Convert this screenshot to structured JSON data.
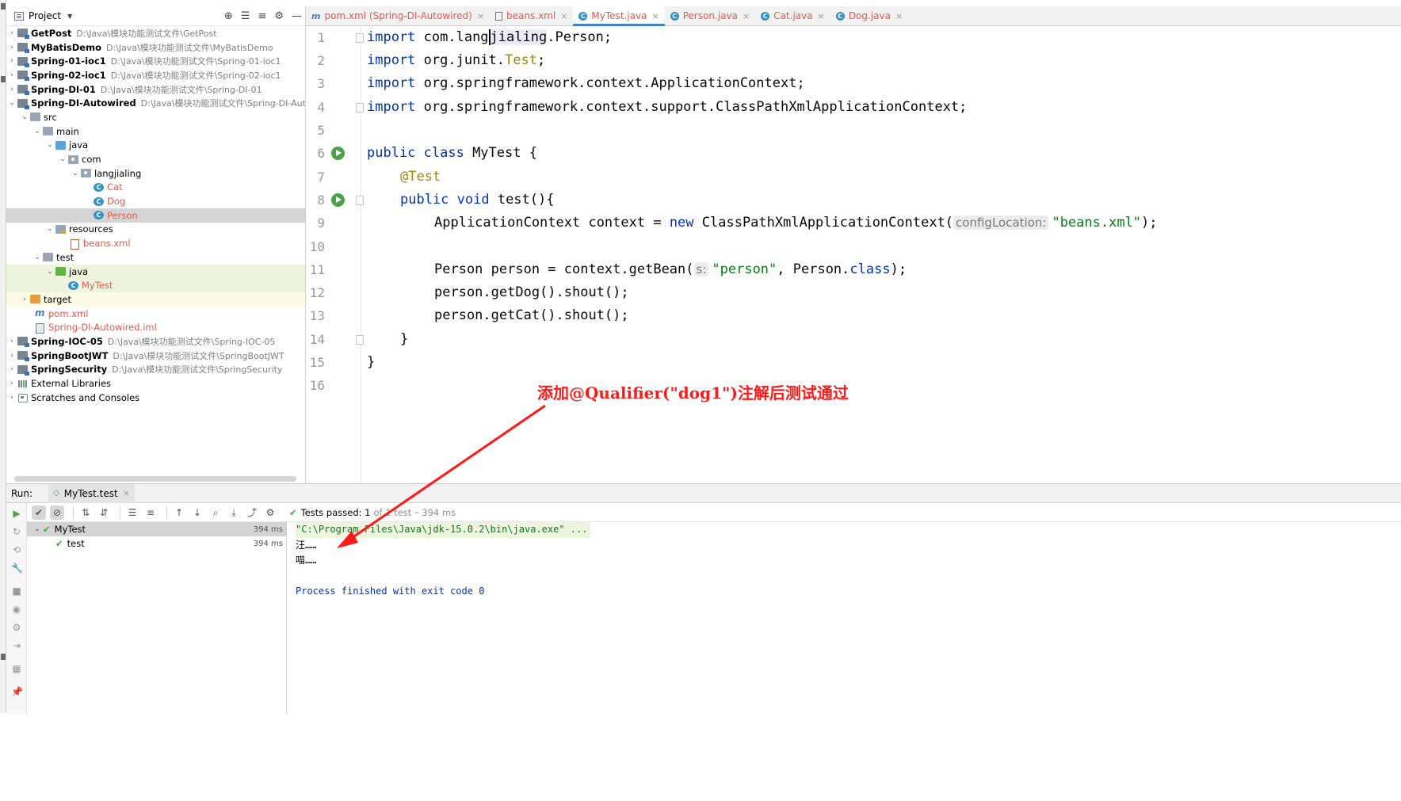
{
  "project": {
    "title": "Project",
    "tree": [
      {
        "name": "GetPost",
        "path": "D:\\Java\\模块功能测试文件\\GetPost"
      },
      {
        "name": "MyBatisDemo",
        "path": "D:\\Java\\模块功能测试文件\\MyBatisDemo"
      },
      {
        "name": "Spring-01-ioc1",
        "path": "D:\\Java\\模块功能测试文件\\Spring-01-ioc1"
      },
      {
        "name": "Spring-02-ioc1",
        "path": "D:\\Java\\模块功能测试文件\\Spring-02-ioc1"
      },
      {
        "name": "Spring-DI-01",
        "path": "D:\\Java\\模块功能测试文件\\Spring-DI-01"
      },
      {
        "name": "Spring-DI-Autowired",
        "path": "D:\\Java\\模块功能测试文件\\Spring-DI-Autowi"
      },
      {
        "name": "src"
      },
      {
        "name": "main"
      },
      {
        "name": "java"
      },
      {
        "name": "com"
      },
      {
        "name": "langjialing"
      },
      {
        "name": "Cat"
      },
      {
        "name": "Dog"
      },
      {
        "name": "Person"
      },
      {
        "name": "resources"
      },
      {
        "name": "beans.xml"
      },
      {
        "name": "test"
      },
      {
        "name": "java"
      },
      {
        "name": "MyTest"
      },
      {
        "name": "target"
      },
      {
        "name": "pom.xml"
      },
      {
        "name": "Spring-DI-Autowired.iml"
      },
      {
        "name": "Spring-IOC-05",
        "path": "D:\\Java\\模块功能测试文件\\Spring-IOC-05"
      },
      {
        "name": "SpringBootJWT",
        "path": "D:\\Java\\模块功能测试文件\\SpringBootJWT"
      },
      {
        "name": "SpringSecurity",
        "path": "D:\\Java\\模块功能测试文件\\SpringSecurity"
      },
      {
        "name": "External Libraries"
      },
      {
        "name": "Scratches and Consoles"
      }
    ]
  },
  "tabs": [
    {
      "label": "pom.xml (Spring-DI-Autowired)",
      "icon": "m"
    },
    {
      "label": "beans.xml",
      "icon": "xml-file-icon"
    },
    {
      "label": "MyTest.java",
      "icon": "class-icon",
      "active": true
    },
    {
      "label": "Person.java",
      "icon": "C"
    },
    {
      "label": "Cat.java",
      "icon": "C"
    },
    {
      "label": "Dog.java",
      "icon": "C"
    }
  ],
  "editor": {
    "line_numbers": [
      "1",
      "2",
      "3",
      "4",
      "5",
      "6",
      "7",
      "8",
      "9",
      "10",
      "11",
      "12",
      "13",
      "14",
      "15",
      "16"
    ],
    "code": {
      "l1_kw": "import",
      "l1_a": " com.lang",
      "l1_b": "j",
      "l1_c": "ialing",
      "l1_d": ".Person;",
      "l2_kw": "import",
      "l2_a": " org.junit.",
      "l2_b": "Test",
      "l2_c": ";",
      "l3_kw": "import",
      "l3_a": " org.springframework.context.ApplicationContext;",
      "l4_kw": "import",
      "l4_a": " org.springframework.context.support.ClassPathXmlApplicationContext;",
      "l6_kw": "public class",
      "l6_a": " MyTest {",
      "l7_ann": "@Test",
      "l8_kw": "public void",
      "l8_a": " test(){",
      "l9_a": "ApplicationContext context = ",
      "l9_kw": "new",
      "l9_b": " ClassPathXmlApplicationContext(",
      "l9_hint": "configLocation:",
      "l9_str": "\"beans.xml\"",
      "l9_c": ");",
      "l11_a": "Person person = context.getBean(",
      "l11_hint": "s:",
      "l11_str": "\"person\"",
      "l11_b": ", Person.",
      "l11_kw": "class",
      "l11_c": ");",
      "l12_a": "person.getDog().shout();",
      "l13_a": "person.getCat().shout();",
      "l14_a": "}",
      "l15_a": "}"
    },
    "annotation": "添加@Qualifier(\"dog1\")注解后测试通过"
  },
  "run": {
    "label": "Run:",
    "tab": "MyTest.test",
    "status_main": "Tests passed: 1",
    "status_muted": "of 1 test – 394 ms",
    "tree": [
      {
        "name": "MyTest",
        "time": "394 ms"
      },
      {
        "name": "test",
        "time": "394 ms"
      }
    ],
    "console": [
      "\"C:\\Program Files\\Java\\jdk-15.0.2\\bin\\java.exe\" ...",
      "汪……",
      "喵……",
      "",
      "Process finished with exit code 0"
    ]
  },
  "colors": {
    "accent": "#4083c9",
    "pass": "#4ca14a",
    "annotation": "#ff1a1a"
  }
}
